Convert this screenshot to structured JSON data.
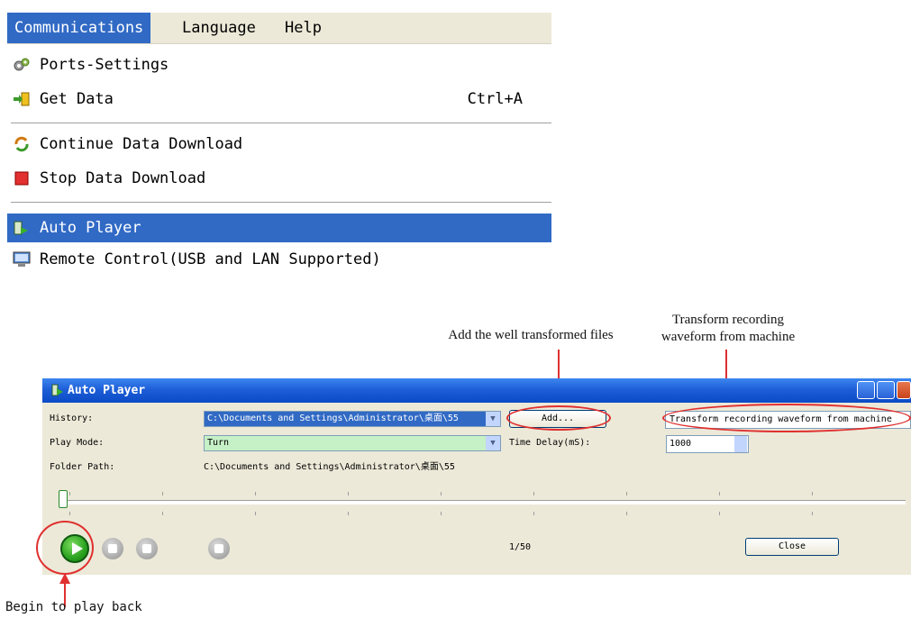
{
  "menubar": {
    "items": [
      "Communications",
      "Language",
      "Help"
    ]
  },
  "menu": {
    "items": [
      {
        "label": "Ports-Settings",
        "shortcut": "",
        "icon": "gear-icon"
      },
      {
        "label": "Get Data",
        "shortcut": "Ctrl+A",
        "icon": "import-icon"
      },
      {
        "label": "Continue Data Download",
        "shortcut": "",
        "icon": "refresh-icon"
      },
      {
        "label": "Stop Data Download",
        "shortcut": "",
        "icon": "stop-icon"
      },
      {
        "label": "Auto Player",
        "shortcut": "",
        "icon": "player-icon"
      },
      {
        "label": "Remote Control(USB and LAN Supported)",
        "shortcut": "",
        "icon": "monitor-icon"
      }
    ],
    "selected": "Auto Player"
  },
  "annotations": {
    "add_files": "Add the well transformed files",
    "transform": "Transform recording waveform from machine",
    "begin": "Begin to play back"
  },
  "player": {
    "title": "Auto Player",
    "history_label": "History:",
    "history_value": "C:\\Documents and Settings\\Administrator\\桌面\\55",
    "add_button": "Add...",
    "transform_button": "Transform recording waveform from machine",
    "playmode_label": "Play Mode:",
    "playmode_value": "Turn",
    "delay_label": "Time Delay(mS):",
    "delay_value": "1000",
    "folder_label": "Folder Path:",
    "folder_value": "C:\\Documents and Settings\\Administrator\\桌面\\55",
    "counter": "1/50",
    "close_button": "Close"
  },
  "colors": {
    "selection": "#316ac5",
    "annotation_red": "#e03030",
    "title_bar": "#1e5fd8",
    "play_green": "#2aa21f"
  }
}
